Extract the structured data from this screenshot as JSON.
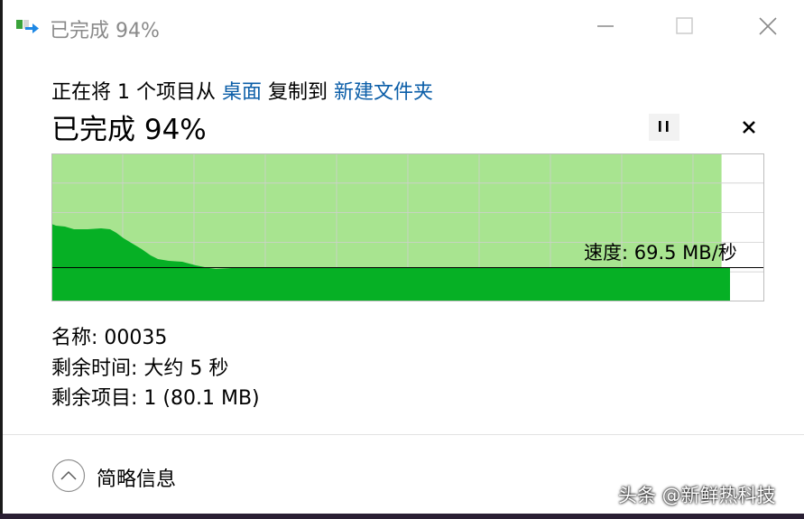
{
  "title": {
    "text": "已完成 94%",
    "icon": "file-copy-icon",
    "buttons": {
      "minimize": "minimize-icon",
      "maximize": "maximize-icon",
      "close": "close-icon"
    }
  },
  "operation": {
    "prefix": "正在将 1 个项目从 ",
    "source": "桌面",
    "middle": " 复制到 ",
    "destination": "新建文件夹"
  },
  "progress": {
    "label": "已完成 94%",
    "percent": 94,
    "pause_icon": "pause-icon",
    "cancel_icon": "cancel-icon"
  },
  "speed_graph": {
    "speed_text": "速度: 69.5 MB/秒",
    "fill_color": "#a8e490",
    "speed_color": "#06b025",
    "grid_color": "#cfcfcf"
  },
  "details": {
    "name": "名称: 00035",
    "time_remaining": "剩余时间: 大约 5 秒",
    "items_remaining": "剩余项目: 1 (80.1 MB)"
  },
  "footer": {
    "toggle_label": "简略信息",
    "toggle_icon": "chevron-up-icon"
  },
  "watermark": "头条 @新鲜热科技"
}
